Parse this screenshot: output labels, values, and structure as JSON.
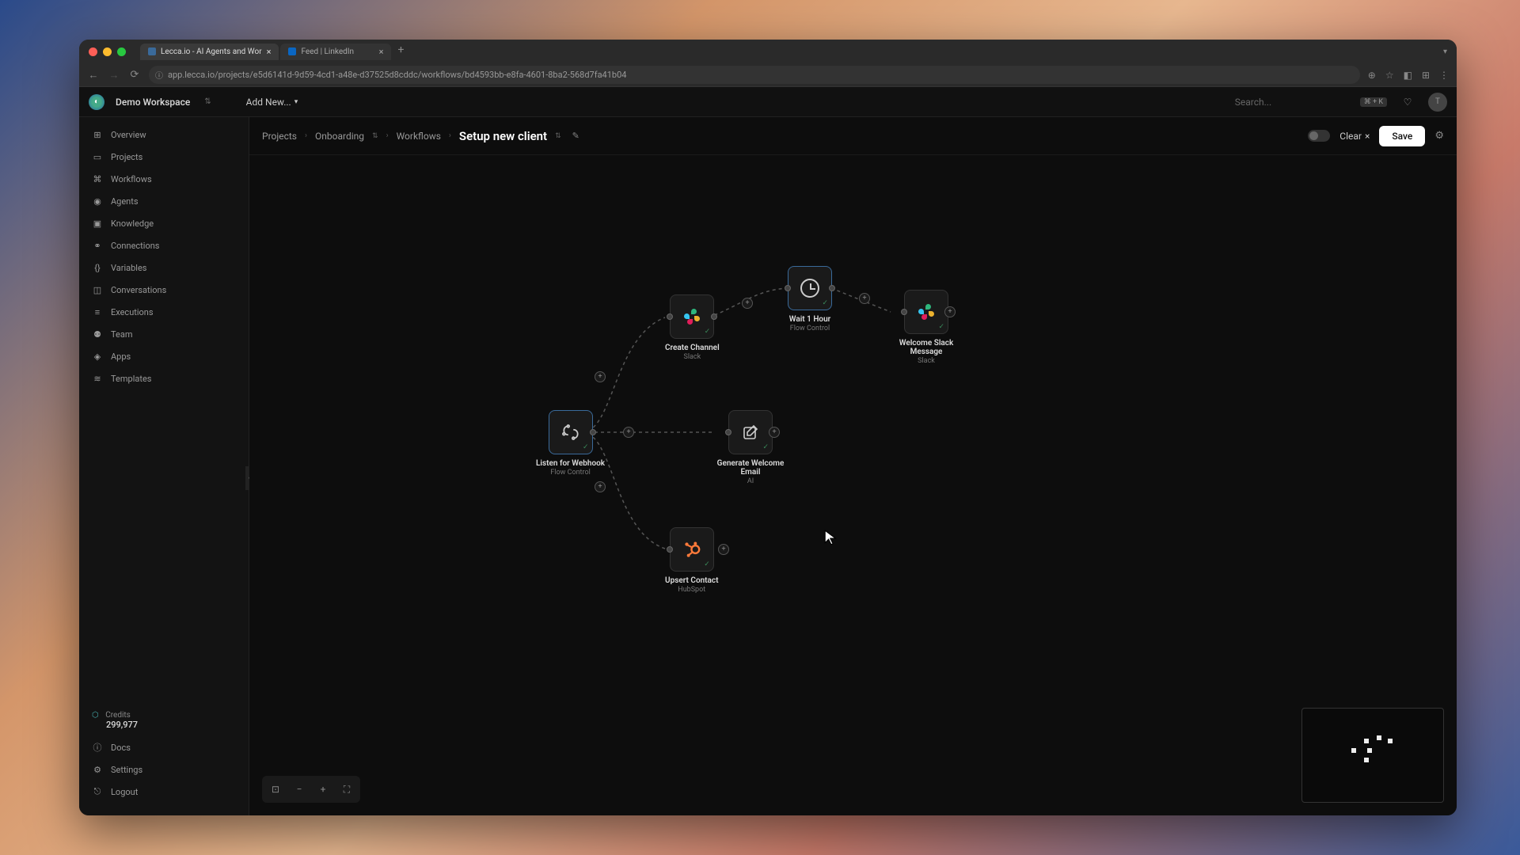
{
  "browser": {
    "tabs": [
      {
        "title": "Lecca.io - AI Agents and Wor",
        "active": true
      },
      {
        "title": "Feed | LinkedIn",
        "active": false
      }
    ],
    "url": "app.lecca.io/projects/e5d6141d-9d59-4cd1-a48e-d37525d8cddc/workflows/bd4593bb-e8fa-4601-8ba2-568d7fa41b04"
  },
  "app": {
    "workspace": "Demo Workspace",
    "add_new": "Add New...",
    "search_placeholder": "Search...",
    "search_kbd": "⌘ + K",
    "avatar": "T"
  },
  "sidebar": {
    "items": [
      "Overview",
      "Projects",
      "Workflows",
      "Agents",
      "Knowledge",
      "Connections",
      "Variables",
      "Conversations",
      "Executions",
      "Team",
      "Apps",
      "Templates"
    ],
    "credits_label": "Credits",
    "credits_value": "299,977",
    "bottom": [
      "Docs",
      "Settings",
      "Logout"
    ]
  },
  "breadcrumb": {
    "projects": "Projects",
    "project": "Onboarding",
    "workflows": "Workflows",
    "current": "Setup new client"
  },
  "toolbar": {
    "clear": "Clear",
    "save": "Save"
  },
  "nodes": {
    "webhook": {
      "title": "Listen for Webhook",
      "sub": "Flow Control"
    },
    "create_channel": {
      "title": "Create Channel",
      "sub": "Slack"
    },
    "wait": {
      "title": "Wait 1 Hour",
      "sub": "Flow Control"
    },
    "welcome_slack": {
      "title": "Welcome Slack Message",
      "sub": "Slack"
    },
    "gen_email": {
      "title": "Generate Welcome Email",
      "sub": "AI"
    },
    "upsert": {
      "title": "Upsert Contact",
      "sub": "HubSpot"
    }
  }
}
